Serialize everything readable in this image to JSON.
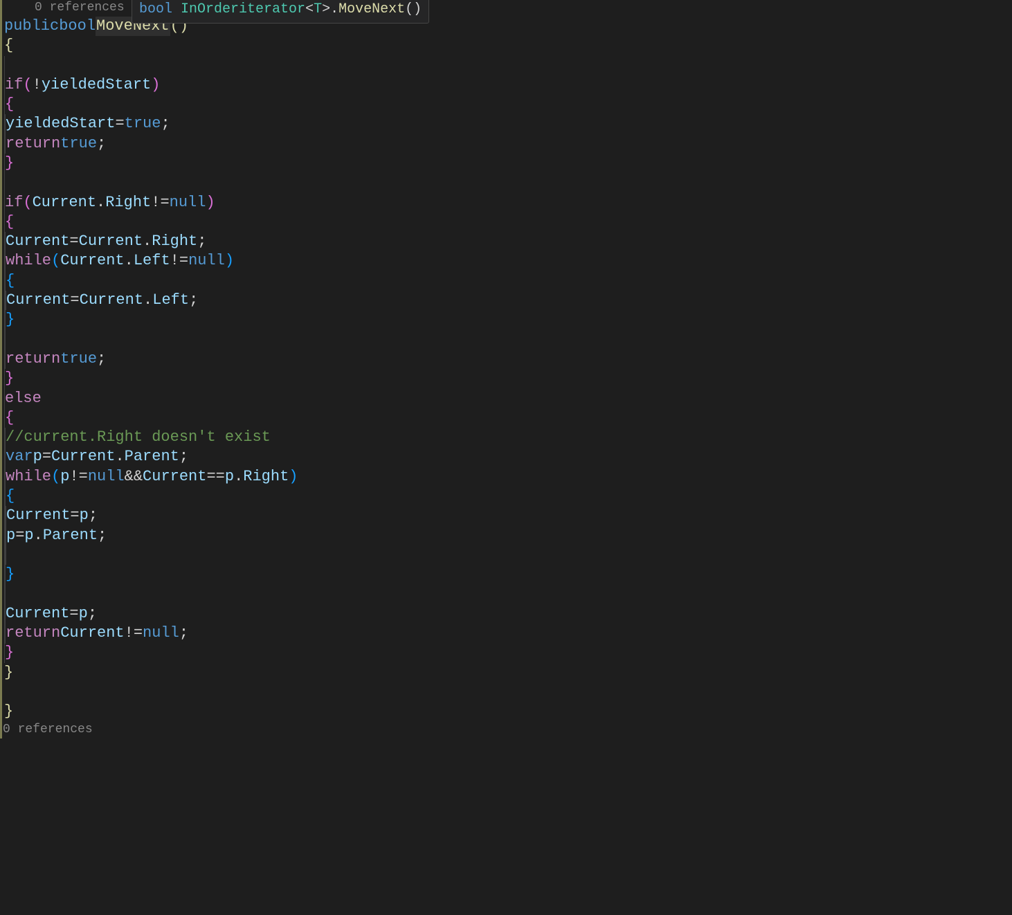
{
  "codelens_top": "0 references",
  "codelens_bottom": "0 references",
  "tooltip": {
    "keyword": "bool",
    "type": "InOrderiterator",
    "generic_open": "<",
    "generic_param": "T",
    "generic_close": ">",
    "dot": ".",
    "method": "MoveNext",
    "parens": "()"
  },
  "sig": {
    "public": "public",
    "bool": "bool",
    "method": "MoveNext",
    "open": "(",
    "close": ")"
  },
  "tokens": {
    "open_brace": "{",
    "close_brace": "}",
    "if": "if",
    "else": "else",
    "while": "while",
    "return": "return",
    "var": "var",
    "true": "true",
    "null": "null",
    "bang": "!",
    "eq": "=",
    "eqeq": "==",
    "neq": "!=",
    "andand": "&&",
    "dot": ".",
    "semi": ";",
    "lparen": "(",
    "rparen": ")",
    "sp": " "
  },
  "ids": {
    "yieldedStart": "yieldedStart",
    "Current": "Current",
    "Right": "Right",
    "Left": "Left",
    "Parent": "Parent",
    "p": "p"
  },
  "comment1": "//current.Right doesn't exist"
}
